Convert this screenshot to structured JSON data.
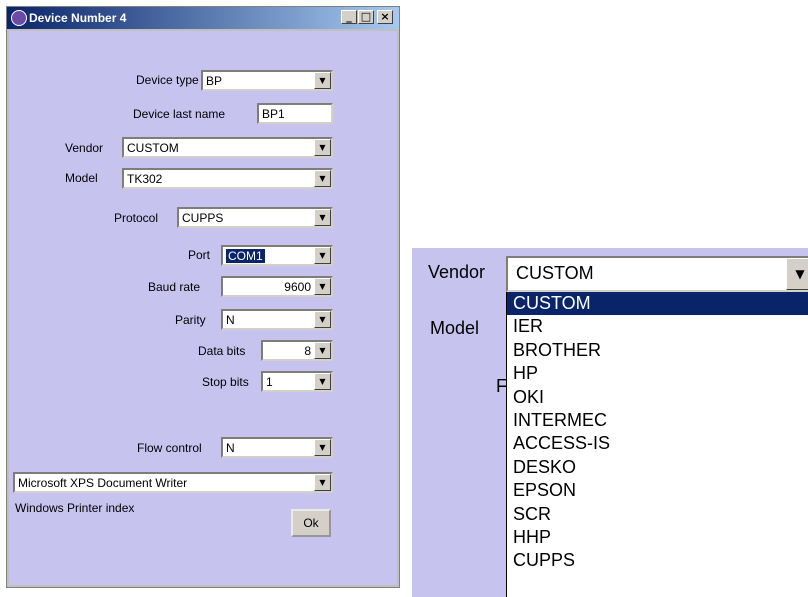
{
  "window": {
    "title": "Device Number 4",
    "min": "_",
    "max": "□",
    "close": "×"
  },
  "form": {
    "device_type": {
      "label": "Device type",
      "value": "BP"
    },
    "device_last_name": {
      "label": "Device last name",
      "value": "BP1"
    },
    "vendor": {
      "label": "Vendor",
      "value": "CUSTOM"
    },
    "model": {
      "label": "Model",
      "value": "TK302"
    },
    "protocol": {
      "label": "Protocol",
      "value": "CUPPS"
    },
    "port": {
      "label": "Port",
      "value": "COM1"
    },
    "baud_rate": {
      "label": "Baud rate",
      "value": "9600"
    },
    "parity": {
      "label": "Parity",
      "value": "N"
    },
    "data_bits": {
      "label": "Data bits",
      "value": "8"
    },
    "stop_bits": {
      "label": "Stop bits",
      "value": "1"
    },
    "flow_control": {
      "label": "Flow control",
      "value": "N"
    },
    "printer": {
      "value": "Microsoft XPS Document Writer"
    },
    "windows_printer_index": {
      "label": "Windows Printer index"
    },
    "ok_label": "Ok"
  },
  "zoom": {
    "vendor_label": "Vendor",
    "vendor_value": "CUSTOM",
    "model_label": "Model",
    "partial_label": "F",
    "options": [
      "CUSTOM",
      "IER",
      "BROTHER",
      "HP",
      "OKI",
      "INTERMEC",
      "ACCESS-IS",
      "DESKO",
      "EPSON",
      "SCR",
      "HHP",
      "CUPPS"
    ]
  },
  "colors": {
    "client_bg": "#c7c3ef",
    "selection": "#0a246a"
  }
}
